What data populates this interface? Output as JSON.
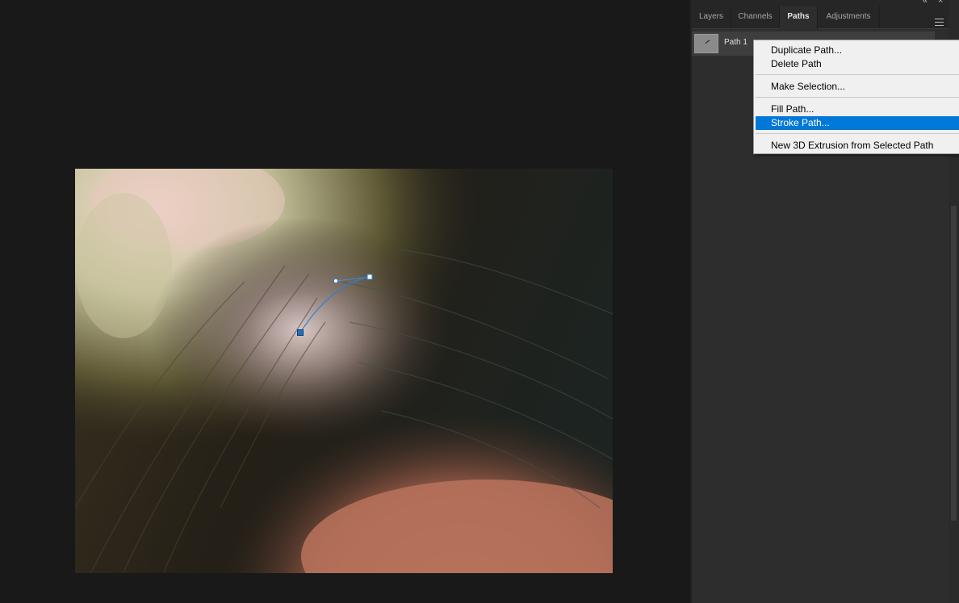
{
  "panel": {
    "tabs": [
      {
        "label": "Layers",
        "active": false
      },
      {
        "label": "Channels",
        "active": false
      },
      {
        "label": "Paths",
        "active": true
      },
      {
        "label": "Adjustments",
        "active": false
      }
    ],
    "collapse_glyph": "«",
    "close_glyph": "×",
    "menu_icon": "hamburger-menu-icon",
    "paths": [
      {
        "name": "Path 1",
        "selected": true
      }
    ]
  },
  "context_menu": {
    "groups": [
      [
        "Duplicate Path...",
        "Delete Path"
      ],
      [
        "Make Selection..."
      ],
      [
        "Fill Path...",
        "Stroke Path..."
      ],
      [
        "New 3D Extrusion from Selected Path"
      ]
    ],
    "highlighted": "Stroke Path..."
  },
  "colors": {
    "workspace": "#191919",
    "panel": "#2d2d2d",
    "menu_highlight": "#0078d7",
    "path_anchor": "#1f6fbf"
  },
  "canvas": {
    "content": "close-up photo of hair with a pen path drawn on it"
  }
}
